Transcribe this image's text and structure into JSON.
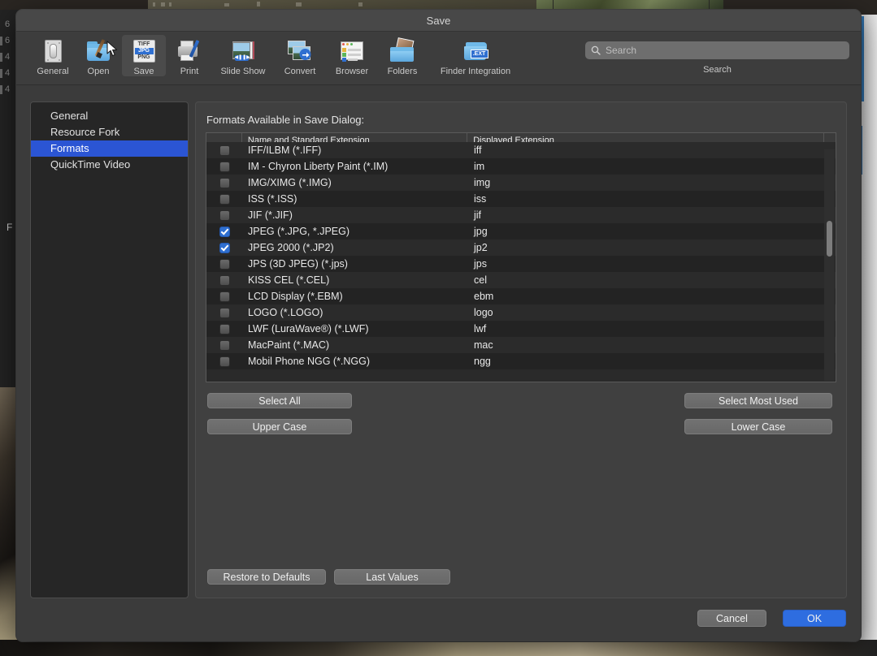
{
  "window": {
    "title": "Save"
  },
  "toolbar": {
    "items": [
      {
        "label": "General",
        "icon": "general-switch-icon"
      },
      {
        "label": "Open",
        "icon": "folder-brush-icon"
      },
      {
        "label": "Save",
        "icon": "file-format-stack-icon",
        "selected": true
      },
      {
        "label": "Print",
        "icon": "printer-icon"
      },
      {
        "label": "Slide Show",
        "icon": "slideshow-icon"
      },
      {
        "label": "Convert",
        "icon": "convert-arrow-icon"
      },
      {
        "label": "Browser",
        "icon": "browser-window-icon"
      },
      {
        "label": "Folders",
        "icon": "folders-photo-icon"
      },
      {
        "label": "Finder Integration",
        "icon": "finder-extension-icon"
      }
    ],
    "save_icon_rows": [
      "TIFF",
      "JPG",
      "PNG"
    ],
    "save_icon_highlight": "JPG",
    "finder_ext_label": ".EXT"
  },
  "search": {
    "placeholder": "Search",
    "value": "",
    "caption": "Search",
    "icon": "search-icon"
  },
  "sidebar": {
    "items": [
      {
        "label": "General",
        "selected": false
      },
      {
        "label": "Resource Fork",
        "selected": false
      },
      {
        "label": "Formats",
        "selected": true
      },
      {
        "label": "QuickTime Video",
        "selected": false
      }
    ]
  },
  "panel": {
    "caption": "Formats Available in Save Dialog:",
    "columns": [
      "",
      "Name and Standard Extension",
      "Displayed Extension",
      ""
    ],
    "rows": [
      {
        "checked": false,
        "name": "IFF/ILBM (*.IFF)",
        "ext": "iff"
      },
      {
        "checked": false,
        "name": "IM  - Chyron Liberty Paint (*.IM)",
        "ext": "im"
      },
      {
        "checked": false,
        "name": "IMG/XIMG (*.IMG)",
        "ext": "img"
      },
      {
        "checked": false,
        "name": "ISS (*.ISS)",
        "ext": "iss"
      },
      {
        "checked": false,
        "name": "JIF (*.JIF)",
        "ext": "jif"
      },
      {
        "checked": true,
        "name": "JPEG (*.JPG, *.JPEG)",
        "ext": "jpg"
      },
      {
        "checked": true,
        "name": "JPEG 2000 (*.JP2)",
        "ext": "jp2"
      },
      {
        "checked": false,
        "name": "JPS (3D JPEG) (*.jps)",
        "ext": "jps"
      },
      {
        "checked": false,
        "name": "KISS CEL (*.CEL)",
        "ext": "cel"
      },
      {
        "checked": false,
        "name": "LCD Display (*.EBM)",
        "ext": "ebm"
      },
      {
        "checked": false,
        "name": "LOGO (*.LOGO)",
        "ext": "logo"
      },
      {
        "checked": false,
        "name": "LWF (LuraWave®) (*.LWF)",
        "ext": "lwf"
      },
      {
        "checked": false,
        "name": "MacPaint (*.MAC)",
        "ext": "mac"
      },
      {
        "checked": false,
        "name": "Mobil Phone NGG (*.NGG)",
        "ext": "ngg"
      }
    ],
    "buttons": {
      "select_all": "Select All",
      "upper_case": "Upper Case",
      "select_most_used": "Select Most Used",
      "lower_case": "Lower Case",
      "restore_defaults": "Restore to Defaults",
      "last_values": "Last Values"
    }
  },
  "footer": {
    "cancel": "Cancel",
    "ok": "OK"
  },
  "background": {
    "left_numbers": [
      "6",
      "6",
      "4",
      "4",
      "4"
    ],
    "left_label": "F"
  },
  "colors": {
    "accent_blue": "#2e6de0",
    "selection_blue": "#2b55d4",
    "checkbox_blue": "#2f6fd0",
    "window_bg": "#3b3b3b",
    "panel_bg": "#404040",
    "sidebar_bg": "#262626",
    "table_row_odd": "#2b2b2b",
    "table_row_even": "#232323"
  }
}
